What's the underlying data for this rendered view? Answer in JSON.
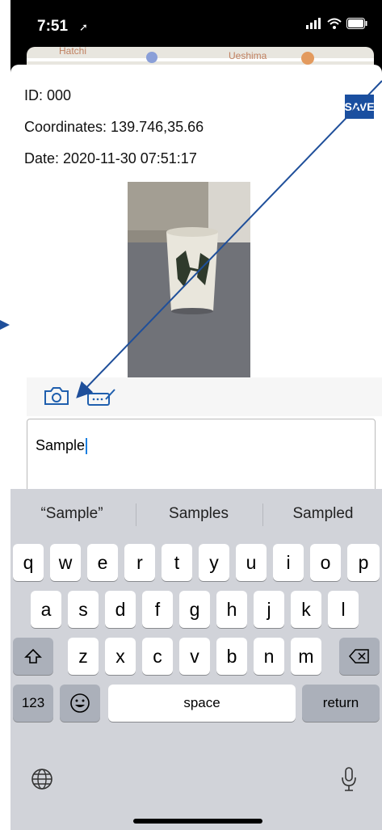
{
  "status_bar": {
    "time": "7:51"
  },
  "map": {
    "label_left": "Hatchi",
    "label_right": "Ueshima"
  },
  "record": {
    "id_text": "ID: 000",
    "coordinates_text": "Coordinates: 139.746,35.66",
    "date_text": "Date: 2020-11-30 07:51:17"
  },
  "toolbar": {
    "save_label": "SAVE"
  },
  "textbox": {
    "value": "Sample"
  },
  "suggestions": [
    "“Sample”",
    "Samples",
    "Sampled"
  ],
  "keyboard": {
    "row1": [
      "q",
      "w",
      "e",
      "r",
      "t",
      "y",
      "u",
      "i",
      "o",
      "p"
    ],
    "row2": [
      "a",
      "s",
      "d",
      "f",
      "g",
      "h",
      "j",
      "k",
      "l"
    ],
    "row3": [
      "z",
      "x",
      "c",
      "v",
      "b",
      "n",
      "m"
    ],
    "numbers_label": "123",
    "space_label": "space",
    "return_label": "return"
  },
  "colors": {
    "accent": "#1a4fa0",
    "annotation_arrow": "#1f4f9a"
  }
}
